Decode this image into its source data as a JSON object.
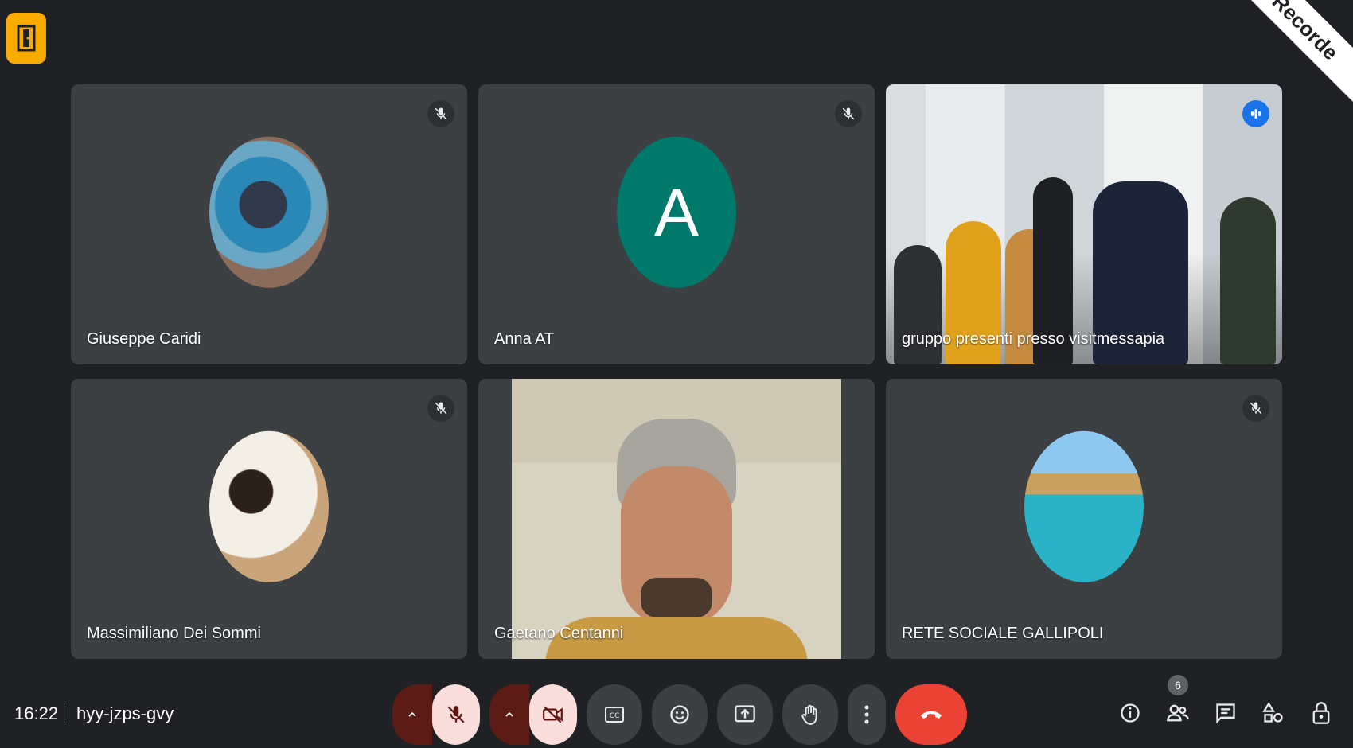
{
  "banner": {
    "label": "Recorde"
  },
  "participants": [
    {
      "name": "Giuseppe Caridi",
      "muted": true,
      "avatar": "diver-photo"
    },
    {
      "name": "Anna AT",
      "muted": true,
      "avatar_letter": "A",
      "avatar_color": "#00796b"
    },
    {
      "name": "gruppo presenti presso visitmessapia",
      "speaking": true,
      "video": "group-room"
    },
    {
      "name": "Massimiliano Dei Sommi",
      "muted": true,
      "avatar": "musician-photo"
    },
    {
      "name": "Gaetano Centanni",
      "video": "person-camera"
    },
    {
      "name": "RETE SOCIALE GALLIPOLI",
      "muted": true,
      "avatar": "harbor-photo"
    }
  ],
  "meeting": {
    "time": "16:22",
    "code": "hyy-jzps-gvy"
  },
  "controls": {
    "mic_state": "off",
    "camera_state": "off",
    "hangup_color": "#ea4335",
    "accent_color": "#8ab4f8"
  },
  "people_count": "6"
}
